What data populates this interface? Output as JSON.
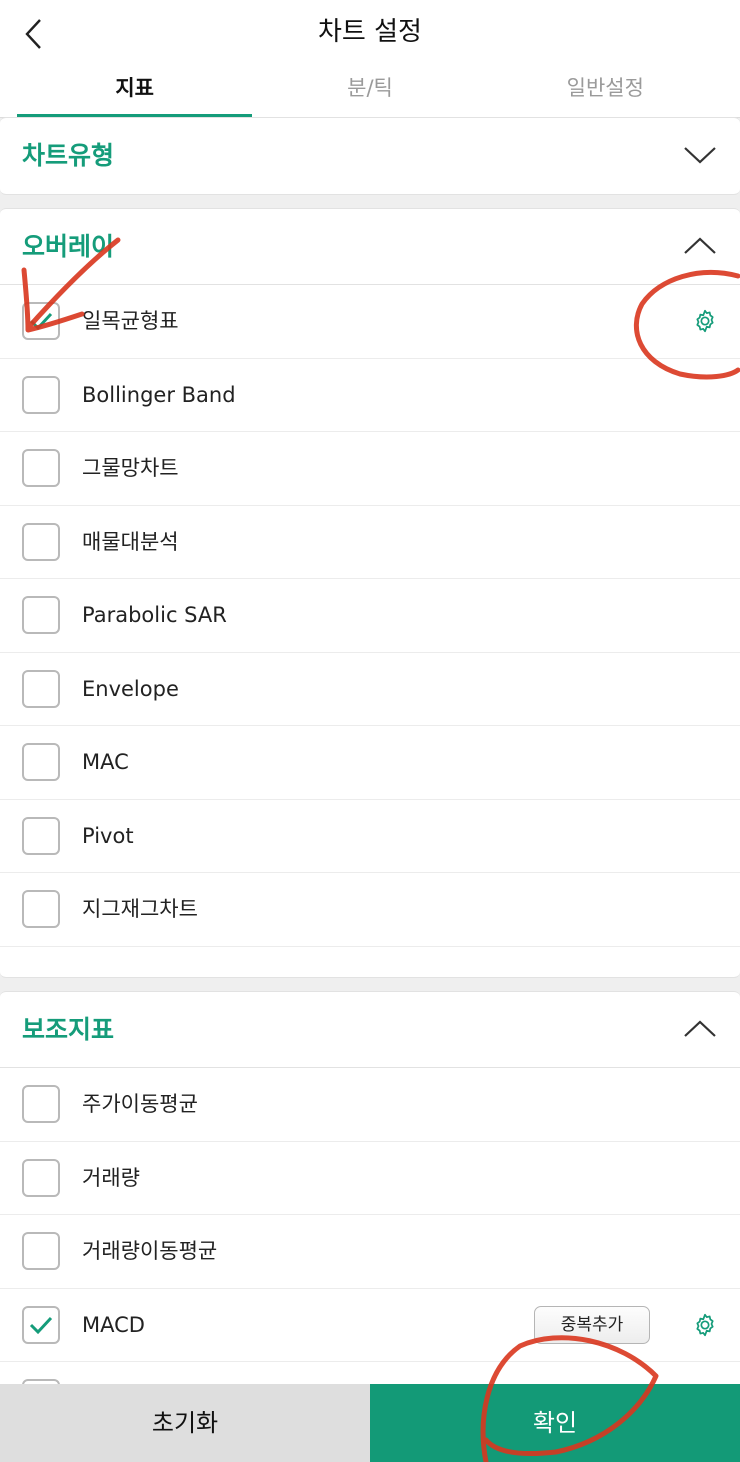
{
  "header": {
    "title": "차트 설정",
    "tabs": [
      {
        "label": "지표",
        "active": true
      },
      {
        "label": "분/틱",
        "active": false
      },
      {
        "label": "일반설정",
        "active": false
      }
    ]
  },
  "sections": {
    "chart_type": {
      "title": "차트유형",
      "expanded": false
    },
    "overlay": {
      "title": "오버레이",
      "expanded": true,
      "items": [
        {
          "label": "일목균형표",
          "checked": true
        },
        {
          "label": "Bollinger Band",
          "checked": false
        },
        {
          "label": "그물망차트",
          "checked": false
        },
        {
          "label": "매물대분석",
          "checked": false
        },
        {
          "label": "Parabolic SAR",
          "checked": false
        },
        {
          "label": "Envelope",
          "checked": false
        },
        {
          "label": "MAC",
          "checked": false
        },
        {
          "label": "Pivot",
          "checked": false
        },
        {
          "label": "지그재그차트",
          "checked": false
        }
      ]
    },
    "sub_indicators": {
      "title": "보조지표",
      "expanded": true,
      "items": [
        {
          "label": "주가이동평균",
          "checked": false
        },
        {
          "label": "거래량",
          "checked": false
        },
        {
          "label": "거래량이동평균",
          "checked": false
        },
        {
          "label": "MACD",
          "checked": true,
          "action_label": "중복추가"
        }
      ]
    }
  },
  "footer": {
    "reset_label": "초기화",
    "confirm_label": "확인"
  },
  "colors": {
    "accent": "#159c7a",
    "confirm_bg": "#139a77",
    "reset_bg": "#dedede",
    "annotation": "#d9361e"
  }
}
